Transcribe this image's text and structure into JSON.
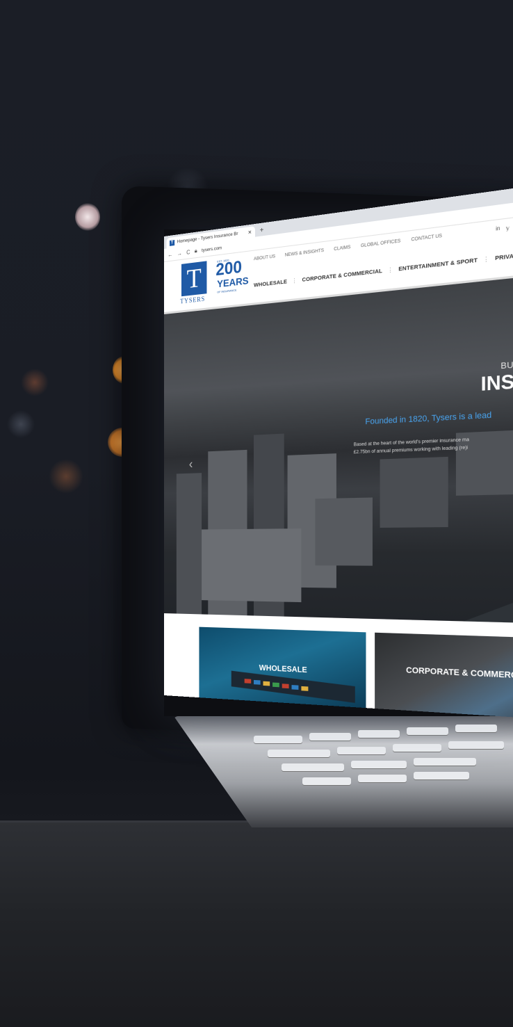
{
  "browser": {
    "tab_title": "Homepage - Tysers Insurance Br",
    "tab_close": "✕",
    "new_tab": "+",
    "url": "tysers.com"
  },
  "site": {
    "logo_letter": "T",
    "logo_word": "TYSERS",
    "badge_est": "EST. 1820",
    "badge_number": "200",
    "badge_years": "YEARS",
    "badge_sub": "OF INSURANCE",
    "top_nav": [
      "ABOUT US",
      "NEWS & INSIGHTS",
      "CLAIMS",
      "GLOBAL OFFICES",
      "CONTACT US"
    ],
    "social": [
      "in",
      "𝕪"
    ],
    "main_nav": [
      "WHOLESALE",
      "CORPORATE & COMMERCIAL",
      "ENTERTAINMENT & SPORT",
      "PRIVATE"
    ]
  },
  "hero": {
    "kicker": "BUILDING RELAT",
    "title": "INSURANCE",
    "subtitle": "Founded in 1820, Tysers is a lead",
    "description_line1": "Based at the heart of the world's premier insurance ma",
    "description_line2": "£2.75bn of annual premiums working with leading (re)i",
    "arrow": "‹"
  },
  "cards": {
    "wholesale": "WHOLESALE",
    "corporate": "CORPORATE & COMMERC"
  },
  "colors": {
    "brand_blue": "#1f5aa6",
    "accent_blue": "#49a4ef"
  }
}
